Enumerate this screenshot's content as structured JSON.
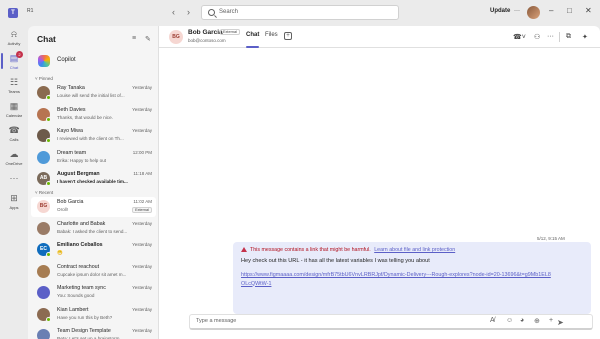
{
  "titlebar": {
    "org_badge": "R1",
    "search_placeholder": "Search",
    "update_label": "Update",
    "more_glyph": "···",
    "back_glyph": "‹",
    "forward_glyph": "›",
    "minimize_glyph": "–",
    "maximize_glyph": "□",
    "close_glyph": "✕"
  },
  "rail": {
    "items": [
      {
        "label": "Activity",
        "icon": "bell-icon",
        "glyph": "⍾"
      },
      {
        "label": "Chat",
        "icon": "chat-icon",
        "glyph": "▤",
        "badge": "2"
      },
      {
        "label": "Teams",
        "icon": "teams-icon",
        "glyph": "☷"
      },
      {
        "label": "Calendar",
        "icon": "calendar-icon",
        "glyph": "▦"
      },
      {
        "label": "Calls",
        "icon": "phone-icon",
        "glyph": "☎"
      },
      {
        "label": "OneDrive",
        "icon": "cloud-icon",
        "glyph": "☁"
      },
      {
        "label": "Apps",
        "icon": "apps-icon",
        "glyph": "⊞"
      }
    ],
    "more_glyph": "···",
    "accent": "#5b5fc7"
  },
  "chat_panel": {
    "title": "Chat",
    "filter_glyph": "≡",
    "compose_glyph": "✎",
    "copilot_label": "Copilot",
    "pinned_header": "˅ Pinned",
    "recent_header": "˅ Recent",
    "pinned": [
      {
        "name": "Ray Tanaka",
        "preview": "Louise will send the initial list of...",
        "time": "Yesterday",
        "avatar_color": "#8a6a4f",
        "status": true
      },
      {
        "name": "Beth Davies",
        "preview": "Thanks, that would be nice.",
        "time": "Yesterday",
        "avatar_color": "#b77451",
        "status": true
      },
      {
        "name": "Kayo Miwa",
        "preview": "I reviewed with the client on Th...",
        "time": "Yesterday",
        "avatar_color": "#6d5a4a",
        "status": true
      },
      {
        "name": "Dream team",
        "preview": "Erika: Happy to help out",
        "time": "12:00 PM",
        "avatar_color": "#4f9ad9",
        "status": false
      },
      {
        "name": "August Bergman",
        "preview": "I haven't checked available tim...",
        "time": "11:18 AM",
        "avatar_color": "#7a6a5a",
        "status": true,
        "bold": true,
        "avatar_text": "AB"
      }
    ],
    "recent": [
      {
        "name": "Bob Garcia",
        "preview": "Oroll!",
        "time": "11:02 AM",
        "external": "External",
        "avatar_color": "#f6d7d2",
        "avatar_text_color": "#9c3d32",
        "avatar_text": "BG",
        "selected": true
      },
      {
        "name": "Charlotte and Babak",
        "preview": "Babak: I asked the client to send...",
        "time": "Yesterday",
        "avatar_color": "#9a7b66",
        "status": false
      },
      {
        "name": "Emiliano Ceballos",
        "preview": "😁",
        "time": "Yesterday",
        "avatar_color": "#0f6cbd",
        "status": true,
        "bold": true,
        "avatar_text": "EC"
      },
      {
        "name": "Contract reachout",
        "preview": "Cupcake ipsum dolor sit amet m...",
        "time": "Yesterday",
        "avatar_color": "#a67c52",
        "status": false
      },
      {
        "name": "Marketing team sync",
        "preview": "You: Sounds good",
        "time": "Yesterday",
        "avatar_color": "#5b5fc7",
        "status": false
      },
      {
        "name": "Kian Lambert",
        "preview": "Have you run this by Beth?",
        "time": "Yesterday",
        "avatar_color": "#8c6b52",
        "status": true
      },
      {
        "name": "Team Design Template",
        "preview": "Reta: Let's set up a brainstorm...",
        "time": "Yesterday",
        "avatar_color": "#6a7fb3",
        "status": false
      }
    ]
  },
  "conversation": {
    "contact_initials": "BG",
    "contact_name": "Bob Garcia",
    "external_badge": "External",
    "contact_email": "bob@contoso.com",
    "tabs": [
      "Chat",
      "Files"
    ],
    "add_tab_glyph": "+",
    "call_glyph": "☎˅",
    "people_glyph": "⚇",
    "more_glyph": "···",
    "popout_glyph": "⧉",
    "copilot_glyph": "✦",
    "message": {
      "timestamp": "5/12, 9:15 AM",
      "warning_text": "This message contains a link that might be harmful.",
      "warning_link": "Learn about file and link protection",
      "body": "Hey check out this URL - it has all the latest variables I was telling you about",
      "url": "https://www.figmaaaa.com/design/mfrB75tbU6VnvLRBRJpf/Dynamic-Delivery---Rough-explores?node-id=20-13696&t=g9Mb1EL8OLcQWtW-1",
      "bubble_color": "#e8ebfa",
      "warning_color": "#b10e1c"
    },
    "composer": {
      "placeholder": "Type a message",
      "format_glyph": "A̸",
      "emoji_glyph": "☺",
      "sticker_glyph": "◕",
      "attach_glyph": "⊕",
      "plus_glyph": "+",
      "send_glyph": "➤"
    }
  }
}
